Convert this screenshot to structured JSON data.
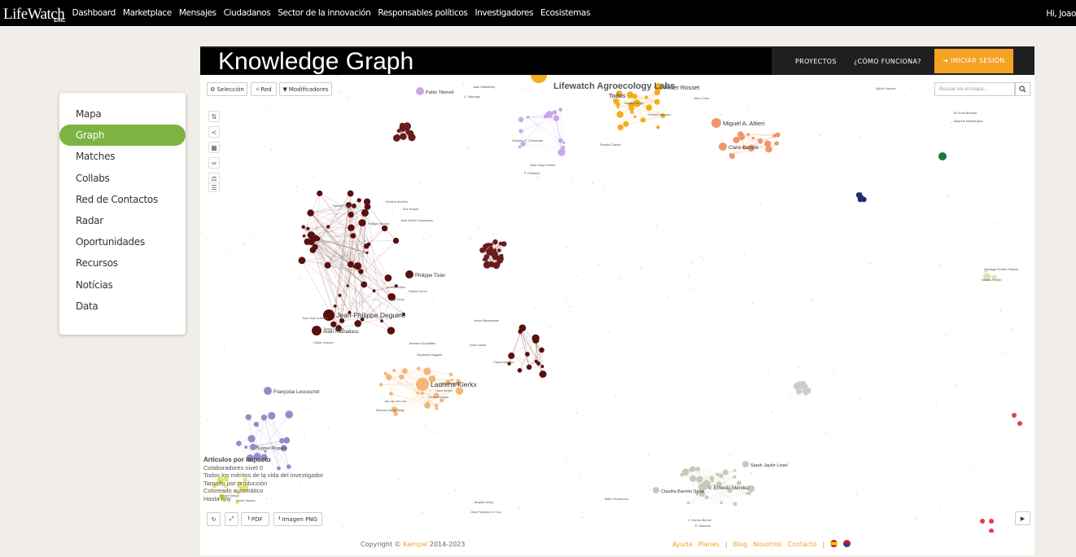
{
  "nav": {
    "logo_main": "LifeWatch",
    "logo_sub": "ERIC",
    "links": [
      "Dashboard",
      "Marketplace",
      "Mensajes",
      "Ciudadanos",
      "Sector de la innovación",
      "Responsables políticos",
      "Investigadores",
      "Ecosistemas"
    ],
    "greeting": "Hi, Joao"
  },
  "sidebar": {
    "items": [
      "Mapa",
      "Graph",
      "Matches",
      "Collabs",
      "Red de Contactos",
      "Radar",
      "Oportunidades",
      "Recursos",
      "Notícias",
      "Data"
    ],
    "active": "Graph"
  },
  "header": {
    "title": "Knowledge Graph",
    "proyectos": "PROYECTOS",
    "como_funciona": "¿CÓMO FUNCIONA?",
    "login": "INICIAR SESIÓN"
  },
  "toolbar": {
    "seleccion": "Selección",
    "red": "Red",
    "modificadores": "Modificadores",
    "search_placeholder": "Buscar en el mapa..."
  },
  "export": {
    "pdf": "PDF",
    "png": "Imagen PNG"
  },
  "legend": {
    "title": "Artículos por impacto",
    "lines": [
      "Colaboradores nivel 0",
      "Todos los méritos de la vida del investigador",
      "Tamaño por producción",
      "Coloreado automático",
      "Hasta hoy"
    ]
  },
  "graph_labels": {
    "big": [
      "Lifewatch Agroecology Labs",
      "Todos",
      "Jean-Philippe Deguine",
      "Laurens Klerkx",
      "Miguel A. Altieri",
      "Peter Rosset",
      "Claire Lamine",
      "Alain Ratnadass",
      "Philippe Tixier",
      "Françoise Lescourret",
      "V. Ernesto Méndez",
      "Claudia Barreto Salas",
      "Pablo Tittonell",
      "Sarah Jaylor Lovel",
      "Lionel Roques"
    ],
    "small": [
      "Antoine Andrieu",
      "Eric Scopel",
      "Jean Michel Sourisseau",
      "Philippe Boulay",
      "Sylvain Pierel",
      "Patrick Caron",
      "Guy Faure",
      "Aurélie Sollier",
      "Jean Noël Aubertot",
      "Bruno Lemaire",
      "Olivier Husson",
      "Jesús Mercadante",
      "Sara Cantin",
      "Carlos Maquez",
      "Bernard Grosdidier",
      "Stephanie Bagarel",
      "Kelly Brennan",
      "Hans Herren",
      "Stefan Kemper",
      "Jan van der Lee",
      "Simone van de Berg",
      "Sergio Ortega",
      "Lionel Hazard",
      "Jacques Wery",
      "Jean-François Le Coq",
      "Marie Hrubesova",
      "Santiago Peredo Parada",
      "Natalia Hunter",
      "Sylvie Dumont",
      "Tor Arvid Breland",
      "Marjorie Mastrangelo",
      "Aitor Cobo",
      "Howard Singh",
      "Glorida Vazquez",
      "Ronald Chavez",
      "Juan Wanderley",
      "G. Marengo",
      "R. Manconi",
      "Jean Hugo Farmer",
      "P. Peterson",
      "V. Gómez Bernal",
      "Stephen R. Gliessman",
      "M.E. Smith"
    ]
  }
}
